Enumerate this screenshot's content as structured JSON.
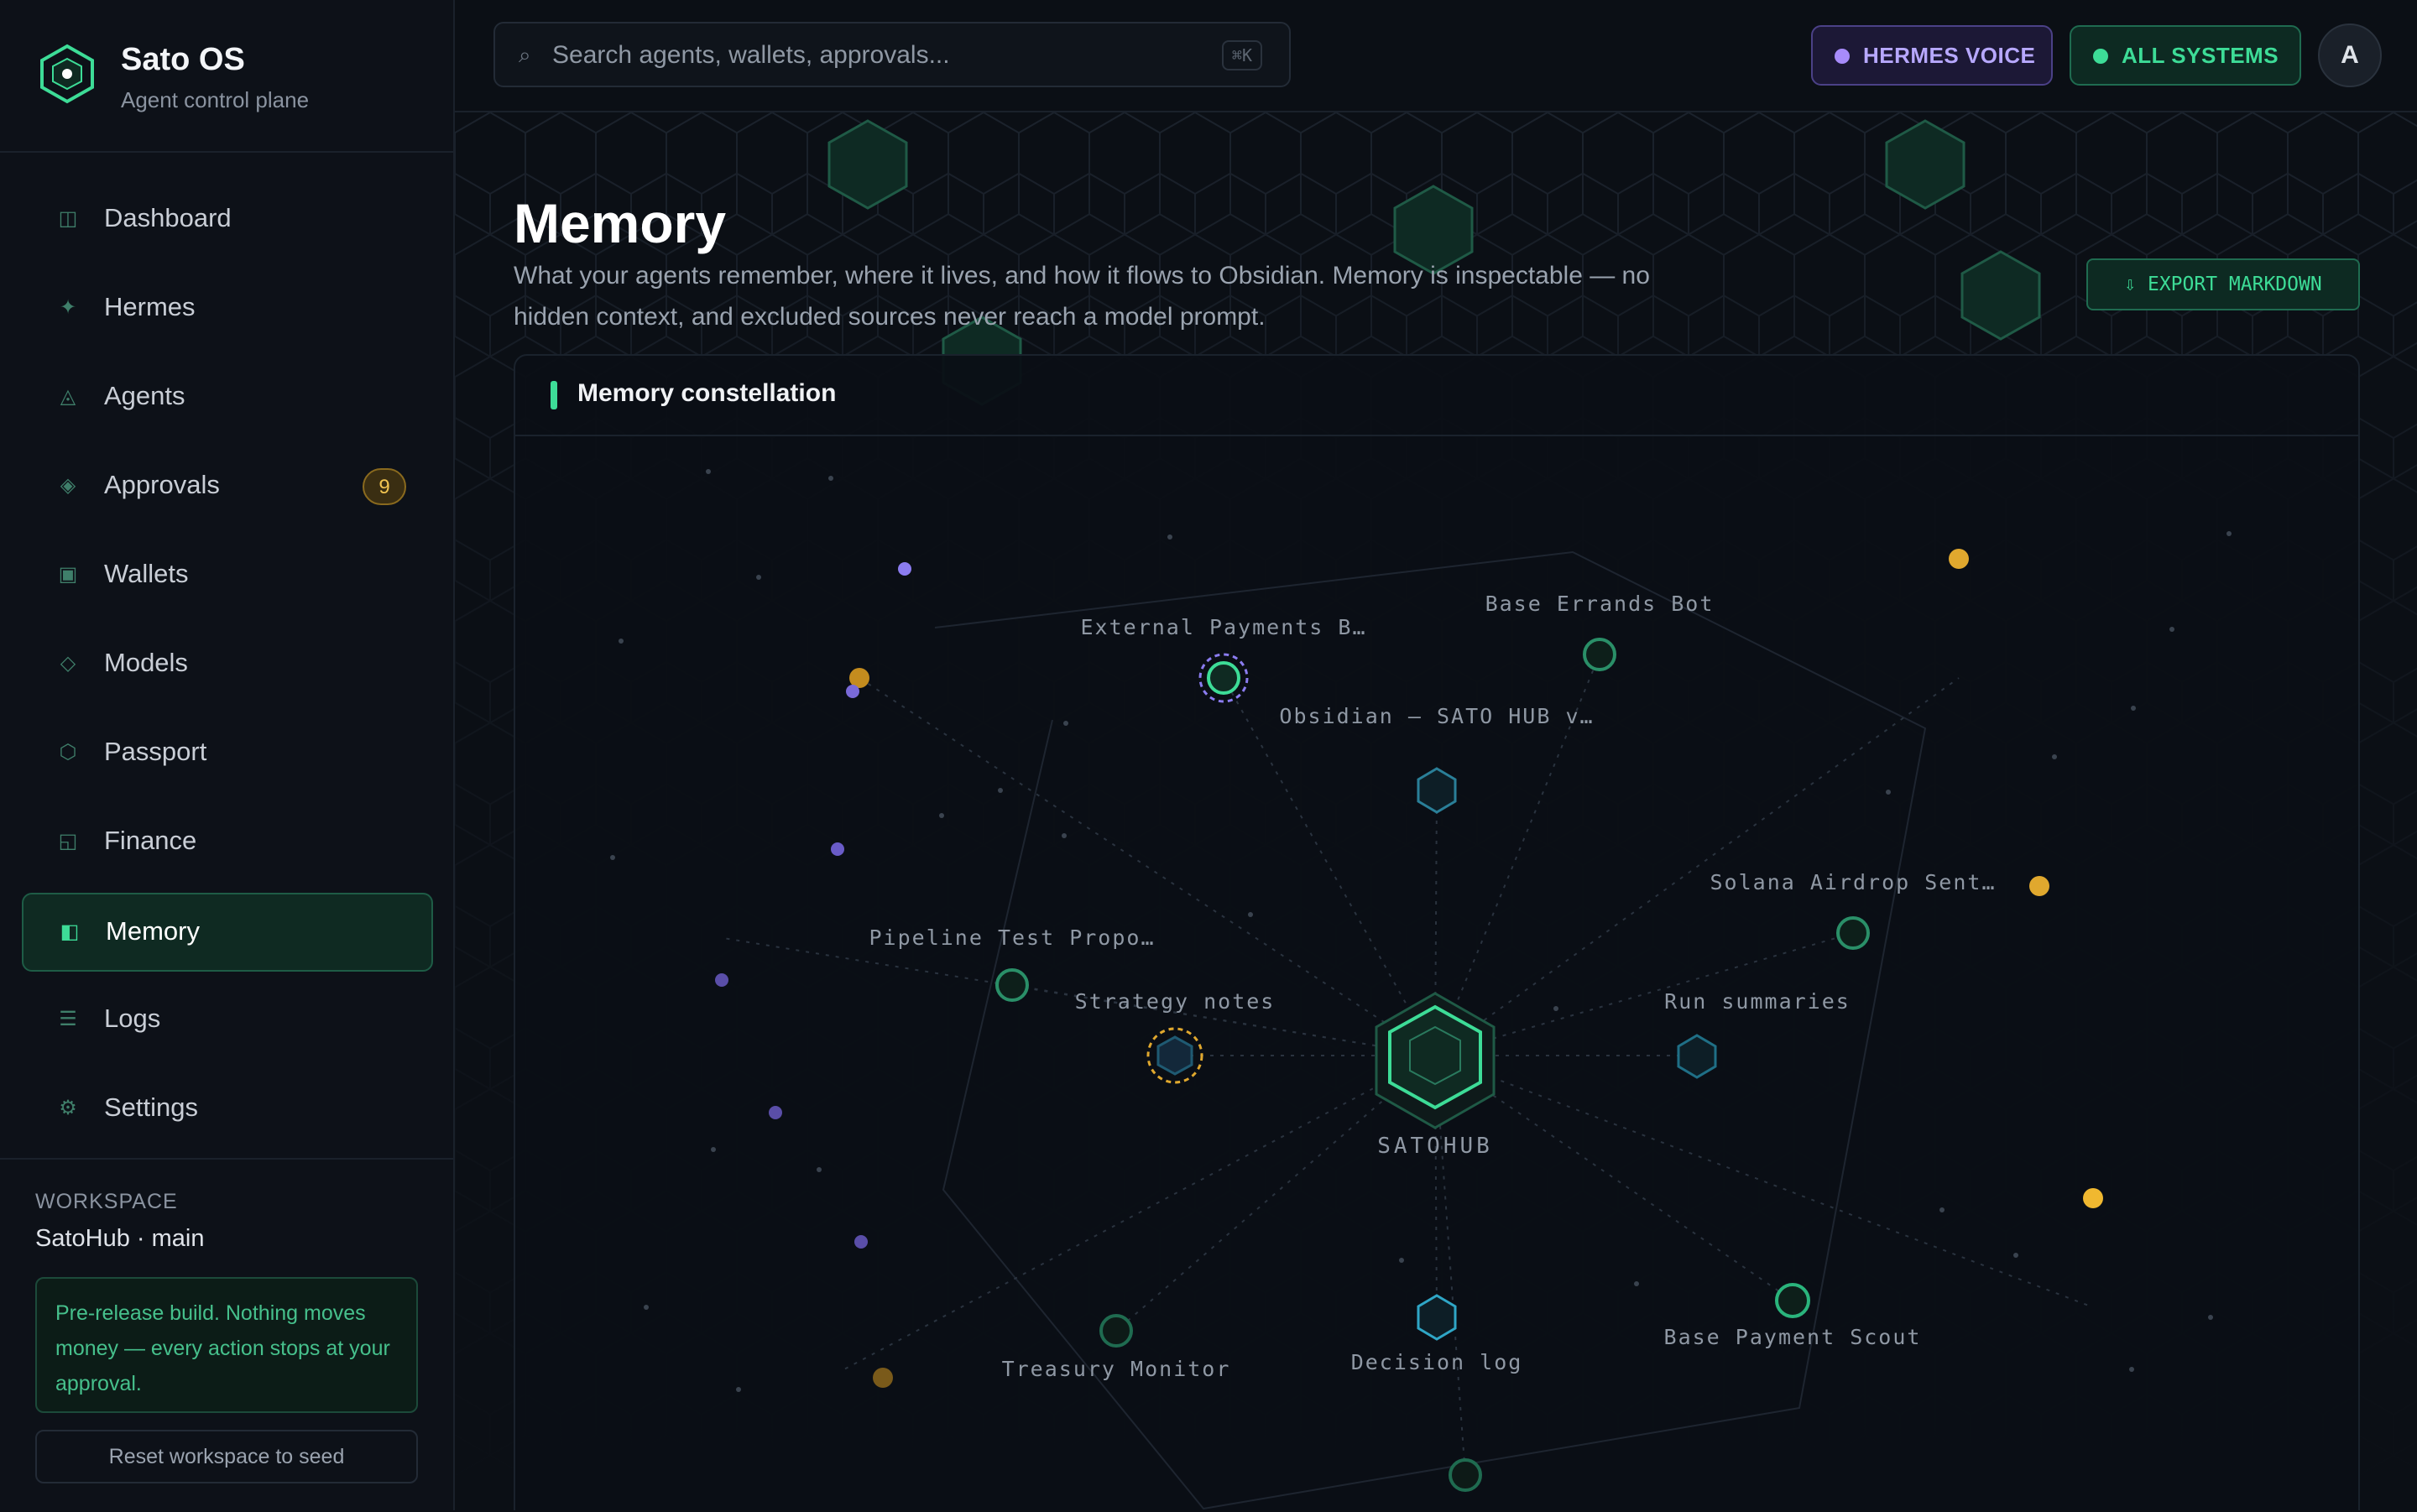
{
  "brand": {
    "title": "Sato OS",
    "subtitle": "Agent control plane"
  },
  "nav": {
    "items": [
      {
        "label": "Dashboard",
        "icon": "dashboard-icon"
      },
      {
        "label": "Hermes",
        "icon": "sparkle-icon"
      },
      {
        "label": "Agents",
        "icon": "triangle-icon"
      },
      {
        "label": "Approvals",
        "icon": "diamond-icon",
        "badge": "9"
      },
      {
        "label": "Wallets",
        "icon": "wallet-icon"
      },
      {
        "label": "Models",
        "icon": "diamond-outline-icon"
      },
      {
        "label": "Passport",
        "icon": "hexagon-icon"
      },
      {
        "label": "Finance",
        "icon": "finance-icon"
      },
      {
        "label": "Memory",
        "icon": "memory-icon",
        "active": true
      },
      {
        "label": "Logs",
        "icon": "list-icon"
      },
      {
        "label": "Settings",
        "icon": "gear-icon"
      }
    ]
  },
  "workspace": {
    "label": "WORKSPACE",
    "name": "SatoHub · main",
    "notice": "Pre-release build. Nothing moves money — every action stops at your approval.",
    "reset_label": "Reset workspace to seed"
  },
  "topbar": {
    "search_placeholder": "Search agents, wallets, approvals...",
    "shortcut": "⌘K",
    "voice_label": "HERMES VOICE",
    "systems_label": "ALL SYSTEMS",
    "avatar_initial": "A"
  },
  "page": {
    "title": "Memory",
    "description": "What your agents remember, where it lives, and how it flows to Obsidian. Memory is inspectable — no hidden context, and excluded sources never reach a model prompt.",
    "export_label": "⇩ EXPORT MARKDOWN"
  },
  "panel": {
    "title": "Memory constellation"
  },
  "graph": {
    "center_label": "SATOHUB",
    "nodes": [
      {
        "label": "External Payments B…",
        "kind": "agent-selected"
      },
      {
        "label": "Base Errands Bot",
        "kind": "agent"
      },
      {
        "label": "Obsidian — SATO HUB v…",
        "kind": "vault"
      },
      {
        "label": "Solana Airdrop Sent…",
        "kind": "agent"
      },
      {
        "label": "Pipeline Test Propo…",
        "kind": "agent"
      },
      {
        "label": "Strategy notes",
        "kind": "memory-excluded"
      },
      {
        "label": "Run summaries",
        "kind": "memory"
      },
      {
        "label": "Decision log",
        "kind": "memory"
      },
      {
        "label": "Base Payment Scout",
        "kind": "agent"
      },
      {
        "label": "Treasury Monitor",
        "kind": "agent"
      }
    ],
    "colors": {
      "accent": "#3ddc97",
      "vault": "#2a9bb8",
      "gold": "#e0a82e",
      "violet": "#8b7cf0"
    }
  }
}
